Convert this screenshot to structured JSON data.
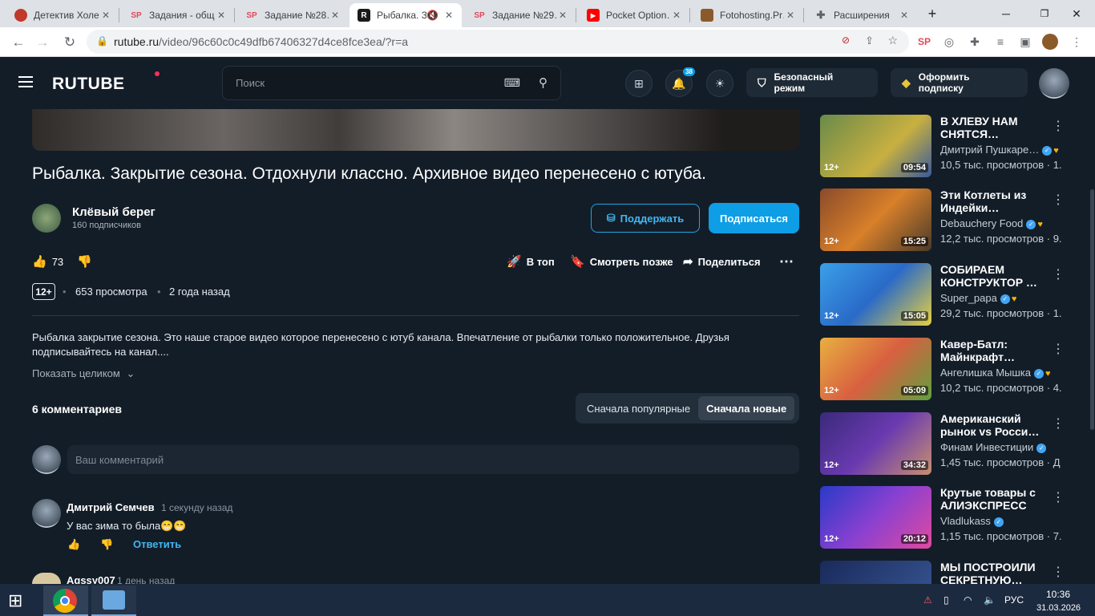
{
  "browser": {
    "tabs": [
      {
        "title": "Детектив Холе…",
        "icon": "red-circle-favicon",
        "color": "#c0392b"
      },
      {
        "title": "Задания - общ…",
        "icon": "sp-favicon",
        "color": "#e04a5a"
      },
      {
        "title": "Задание №28…",
        "icon": "sp-favicon",
        "color": "#e04a5a"
      },
      {
        "title": "Рыбалка. З…",
        "icon": "rutube-favicon",
        "color": "#1a1a1a",
        "muted_icon": "speaker-muted-icon"
      },
      {
        "title": "Задание №29…",
        "icon": "sp-favicon",
        "color": "#e04a5a"
      },
      {
        "title": "Pocket Option…",
        "icon": "youtube-favicon",
        "color": "#ff0000"
      },
      {
        "title": "Fotohosting.Pr…",
        "icon": "photo-favicon",
        "color": "#8b5a2b"
      },
      {
        "title": "Расширения",
        "icon": "puzzle-favicon",
        "color": "#5f6368"
      }
    ],
    "url_host": "rutube.ru",
    "url_path": "/video/96c60c0c49dfb67406327d4ce8fce3ea/?r=a"
  },
  "header": {
    "logo": "RUTUBE",
    "search_placeholder": "Поиск",
    "notifications_count": "38",
    "safe_mode_label": "Безопасный режим",
    "subscribe_label": "Оформить подписку"
  },
  "video": {
    "title": "Рыбалка. Закрытие сезона. Отдохнули классно. Архивное видео перенесено с ютуба.",
    "channel_name": "Клёвый берег",
    "channel_subs": "160 подписчиков",
    "support_label": "Поддержать",
    "subscribe_label": "Подписаться",
    "likes": "73",
    "to_top_label": "В топ",
    "watch_later_label": "Смотреть позже",
    "share_label": "Поделиться",
    "age_rating": "12+",
    "views": "653 просмотра",
    "published": "2 года назад",
    "description": "Рыбалка закрытие сезона. Это наше старое видео которое перенесено с ютуб канала. Впечатление от рыбалки только положительное. Друзья подписывайтесь на канал....",
    "show_all_label": "Показать целиком"
  },
  "comments": {
    "count_label": "6 комментариев",
    "sort_popular": "Сначала популярные",
    "sort_new": "Сначала новые",
    "input_placeholder": "Ваш комментарий",
    "items": [
      {
        "author": "Дмитрий Семчев",
        "time": "1 секунду назад",
        "text": "У вас зима то была😁😁",
        "reply_label": "Ответить"
      },
      {
        "author": "Agssy007",
        "time": "1 день назад"
      }
    ]
  },
  "recommendations": [
    {
      "title": "В ХЛЕВУ НАМ СНЯТСЯ…",
      "channel": "Дмитрий Пушкаре…",
      "views": "10,5 тыс. просмотров · 1.",
      "age": "12+",
      "duration": "09:54",
      "thumb_color": "#6a8a4a"
    },
    {
      "title": "Эти Котлеты из Индейки…",
      "channel": "Debauchery Food",
      "views": "12,2 тыс. просмотров · 9.",
      "age": "12+",
      "duration": "15:25",
      "thumb_color": "#b8602a"
    },
    {
      "title": "СОБИРАЕМ КОНСТРУКТОР …",
      "channel": "Super_papa",
      "views": "29,2 тыс. просмотров · 1.",
      "age": "12+",
      "duration": "15:05",
      "thumb_color": "#2a7ac8"
    },
    {
      "title": "Кавер-Батл: Майнкрафт…",
      "channel": "Ангелишка Мышка",
      "views": "10,2 тыс. просмотров · 4.",
      "age": "12+",
      "duration": "05:09",
      "thumb_color": "#d8a040"
    },
    {
      "title": "Американский рынок vs Росси…",
      "channel": "Финам Инвестиции",
      "views": "1,45 тыс. просмотров · Д",
      "age": "12+",
      "duration": "34:32",
      "thumb_color": "#5a3a9a"
    },
    {
      "title": "Крутые товары с АЛИЭКСПРЕСС",
      "channel": "Vladlukass",
      "views": "1,15 тыс. просмотров · 7.",
      "age": "12+",
      "duration": "20:12",
      "thumb_color": "#3a4ac8"
    },
    {
      "title": "МЫ ПОСТРОИЛИ СЕКРЕТНУЮ…",
      "thumb_color": "#2a3a6a"
    }
  ],
  "taskbar": {
    "lang": "РУС",
    "time": "10:36",
    "date": "31.03.2026"
  }
}
